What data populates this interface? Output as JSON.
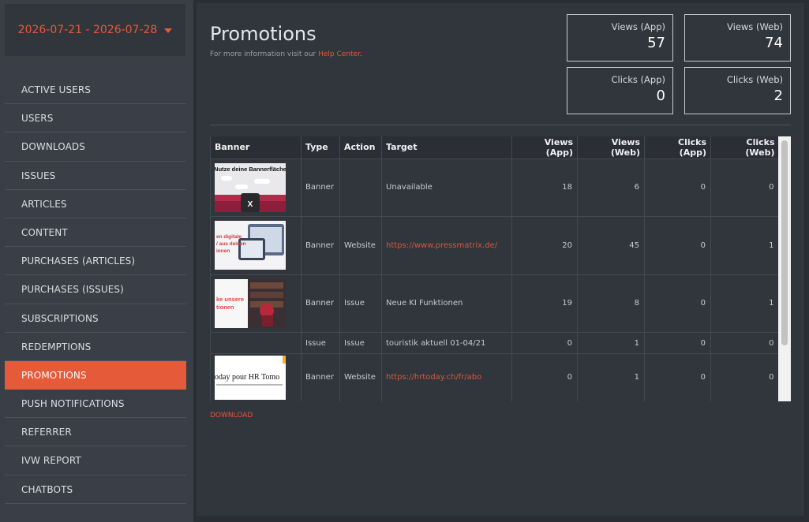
{
  "date_range": "2026-07-21 - 2026-07-28",
  "nav": [
    {
      "label": "ACTIVE USERS",
      "active": false
    },
    {
      "label": "USERS",
      "active": false
    },
    {
      "label": "DOWNLOADS",
      "active": false
    },
    {
      "label": "ISSUES",
      "active": false
    },
    {
      "label": "ARTICLES",
      "active": false
    },
    {
      "label": "CONTENT",
      "active": false
    },
    {
      "label": "PURCHASES (ARTICLES)",
      "active": false
    },
    {
      "label": "PURCHASES (ISSUES)",
      "active": false
    },
    {
      "label": "SUBSCRIPTIONS",
      "active": false
    },
    {
      "label": "REDEMPTIONS",
      "active": false
    },
    {
      "label": "PROMOTIONS",
      "active": true
    },
    {
      "label": "PUSH NOTIFICATIONS",
      "active": false
    },
    {
      "label": "REFERRER",
      "active": false
    },
    {
      "label": "IVW REPORT",
      "active": false
    },
    {
      "label": "CHATBOTS",
      "active": false
    }
  ],
  "page": {
    "title": "Promotions",
    "subtitle_prefix": "For more information visit our ",
    "help_link": "Help Center",
    "subtitle_suffix": "."
  },
  "stats": {
    "views_app": {
      "label": "Views (App)",
      "value": "57"
    },
    "views_web": {
      "label": "Views (Web)",
      "value": "74"
    },
    "clicks_app": {
      "label": "Clicks (App)",
      "value": "0"
    },
    "clicks_web": {
      "label": "Clicks (Web)",
      "value": "2"
    }
  },
  "table": {
    "headers": [
      "Banner",
      "Type",
      "Action",
      "Target",
      "Views (App)",
      "Views (Web)",
      "Clicks (App)",
      "Clicks (Web)"
    ],
    "rows": [
      {
        "thumb": "Nutze deine Bannerfläche",
        "type": "Banner",
        "action": "",
        "target": "Unavailable",
        "target_link": false,
        "views_app": "18",
        "views_web": "6",
        "clicks_app": "0",
        "clicks_web": "0"
      },
      {
        "thumb": "en digitale / aus deinen / ionen",
        "type": "Banner",
        "action": "Website",
        "target": "https://www.pressmatrix.de/",
        "target_link": true,
        "views_app": "20",
        "views_web": "45",
        "clicks_app": "0",
        "clicks_web": "1"
      },
      {
        "thumb": "ke unsere / tionen",
        "type": "Banner",
        "action": "Issue",
        "target": "Neue KI Funktionen",
        "target_link": false,
        "views_app": "19",
        "views_web": "8",
        "clicks_app": "0",
        "clicks_web": "1"
      },
      {
        "thumb": "",
        "type": "Issue",
        "action": "Issue",
        "target": "touristik aktuell 01-04/21",
        "target_link": false,
        "views_app": "0",
        "views_web": "1",
        "clicks_app": "0",
        "clicks_web": "0"
      },
      {
        "thumb": "oday pour HR Tomo",
        "type": "Banner",
        "action": "Website",
        "target": "https://hrtoday.ch/fr/abo",
        "target_link": true,
        "views_app": "0",
        "views_web": "1",
        "clicks_app": "0",
        "clicks_web": "0"
      }
    ]
  },
  "download_label": "DOWNLOAD",
  "colors": {
    "accent": "#e55a38",
    "sidebar_bg": "#3a3f47",
    "panel_bg": "#31353c"
  }
}
